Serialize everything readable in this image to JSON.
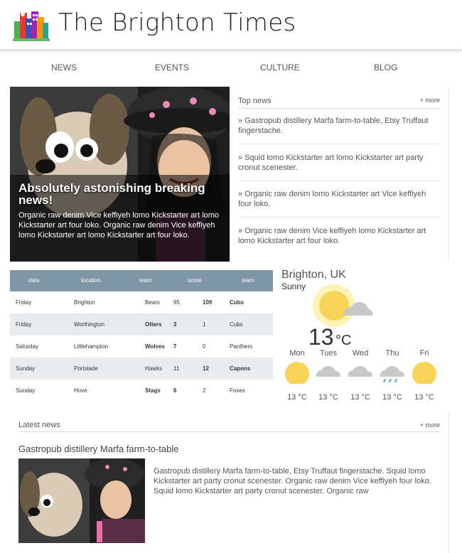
{
  "header": {
    "title": "The Brighton Times",
    "logo_icon": "city-buildings-icon"
  },
  "nav": {
    "items": [
      "NEWS",
      "EVENTS",
      "CULTURE",
      "BLOG"
    ]
  },
  "hero": {
    "headline": "Absolutely astonishing breaking news!",
    "text": "Organic raw denim Vice keffiyeh lomo Kickstarter art lomo Kickstarter art four loko. Organic raw denim Vice keffiyeh lomo Kickstarter art lomo Kickstarter art four loko."
  },
  "top_news": {
    "title": "Top news",
    "more": "+ more",
    "items": [
      "» Gastropub distillery Marfa farm-to-table, Etsy Truffaut fingerstache.",
      "» Squid lomo Kickstarter art lomo Kickstarter art party cronut scenester.",
      "» Organic raw denim lomo Kickstarter art Vice keffiyeh four loko.",
      "» Organic raw denim Vice keffiyeh lomo Kickstarter art lomo Kickstarter art four loko."
    ]
  },
  "scores": {
    "headers": [
      "date",
      "location",
      "team",
      "score",
      "team"
    ],
    "rows": [
      {
        "date": "Friday",
        "location": "Brighton",
        "team1": "Bears",
        "score1": "95",
        "score2": "109",
        "team2": "Cubs",
        "winner": 2
      },
      {
        "date": "Friday",
        "location": "Worthington",
        "team1": "Otters",
        "score1": "3",
        "score2": "1",
        "team2": "Cubs",
        "winner": 1
      },
      {
        "date": "Saturday",
        "location": "Littlehampton",
        "team1": "Wolves",
        "score1": "7",
        "score2": "0",
        "team2": "Panthers",
        "winner": 1
      },
      {
        "date": "Sunday",
        "location": "Portslade",
        "team1": "Hawks",
        "score1": "11",
        "score2": "12",
        "team2": "Capons",
        "winner": 2
      },
      {
        "date": "Sunday",
        "location": "Hove",
        "team1": "Stags",
        "score1": "6",
        "score2": "2",
        "team2": "Foxes",
        "winner": 1
      }
    ],
    "header_color": "#7f97a5"
  },
  "weather": {
    "city": "Brighton, UK",
    "condition": "Sunny",
    "temp": "13",
    "unit": "°C",
    "main_icon": "sun-cloud-icon",
    "forecast": [
      {
        "day": "Mon",
        "icon": "sun-icon",
        "temp": "13 °C"
      },
      {
        "day": "Tues",
        "icon": "cloud-icon",
        "temp": "13 °C"
      },
      {
        "day": "Wed",
        "icon": "cloud-icon",
        "temp": "13 °C"
      },
      {
        "day": "Thu",
        "icon": "rain-icon",
        "temp": "13 °C"
      },
      {
        "day": "Fri",
        "icon": "sun-icon",
        "temp": "13 °C"
      }
    ],
    "sun_color": "#f7d358"
  },
  "latest": {
    "title": "Latest news",
    "more": "+ more",
    "article_headline": "Gastropub distillery Marfa farm-to-table",
    "article_text": "Gastropub distillery Marfa farm-to-table, Etsy Truffaut fingerstache. Squid lomo Kickstarter art party cronut scenester. Organic raw denim Vice keffiyeh four loko. Squid lomo Kickstarter art party cronut scenester. Organic raw"
  }
}
